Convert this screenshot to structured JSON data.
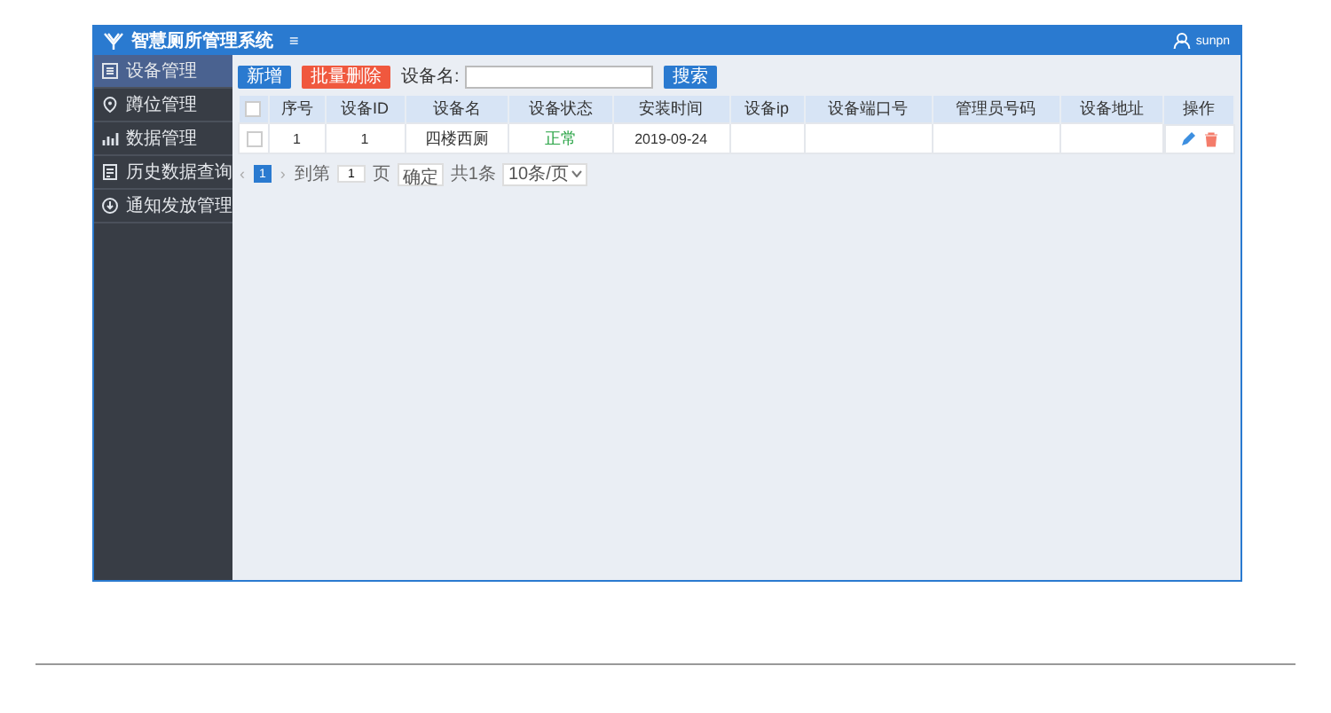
{
  "header": {
    "title": "智慧厕所管理系统",
    "menu_toggle": "≡",
    "user": "sunpn"
  },
  "sidebar": {
    "items": [
      {
        "label": "设备管理",
        "selected": true
      },
      {
        "label": "蹲位管理",
        "selected": false
      },
      {
        "label": "数据管理",
        "selected": false
      },
      {
        "label": "历史数据查询",
        "selected": false
      },
      {
        "label": "通知发放管理",
        "selected": false
      }
    ]
  },
  "toolbar": {
    "buttons": [
      {
        "label": "新增",
        "kind": "primary"
      },
      {
        "label": "批量删除",
        "kind": "danger"
      }
    ],
    "search_label": "设备名:",
    "search_button": "搜索"
  },
  "table": {
    "select_all_checked": false,
    "columns": [
      "序号",
      "设备ID",
      "设备名",
      "设备状态",
      "安装时间",
      "设备ip",
      "设备端口号",
      "管理员号码",
      "设备地址",
      "操作"
    ],
    "rows": [
      {
        "checked": false,
        "cells": [
          "1",
          "1",
          "四楼西厕",
          "正常",
          "2019-09-24",
          "",
          "",
          "",
          ""
        ]
      }
    ]
  },
  "pagination": {
    "prev": "‹",
    "next": "›",
    "pages": [
      {
        "label": "1",
        "selected": true
      }
    ],
    "goto_label": "到第",
    "page_value": "1",
    "page_unit": "页",
    "confirm": "确定",
    "total": "共1条",
    "page_size": "10条/页"
  }
}
